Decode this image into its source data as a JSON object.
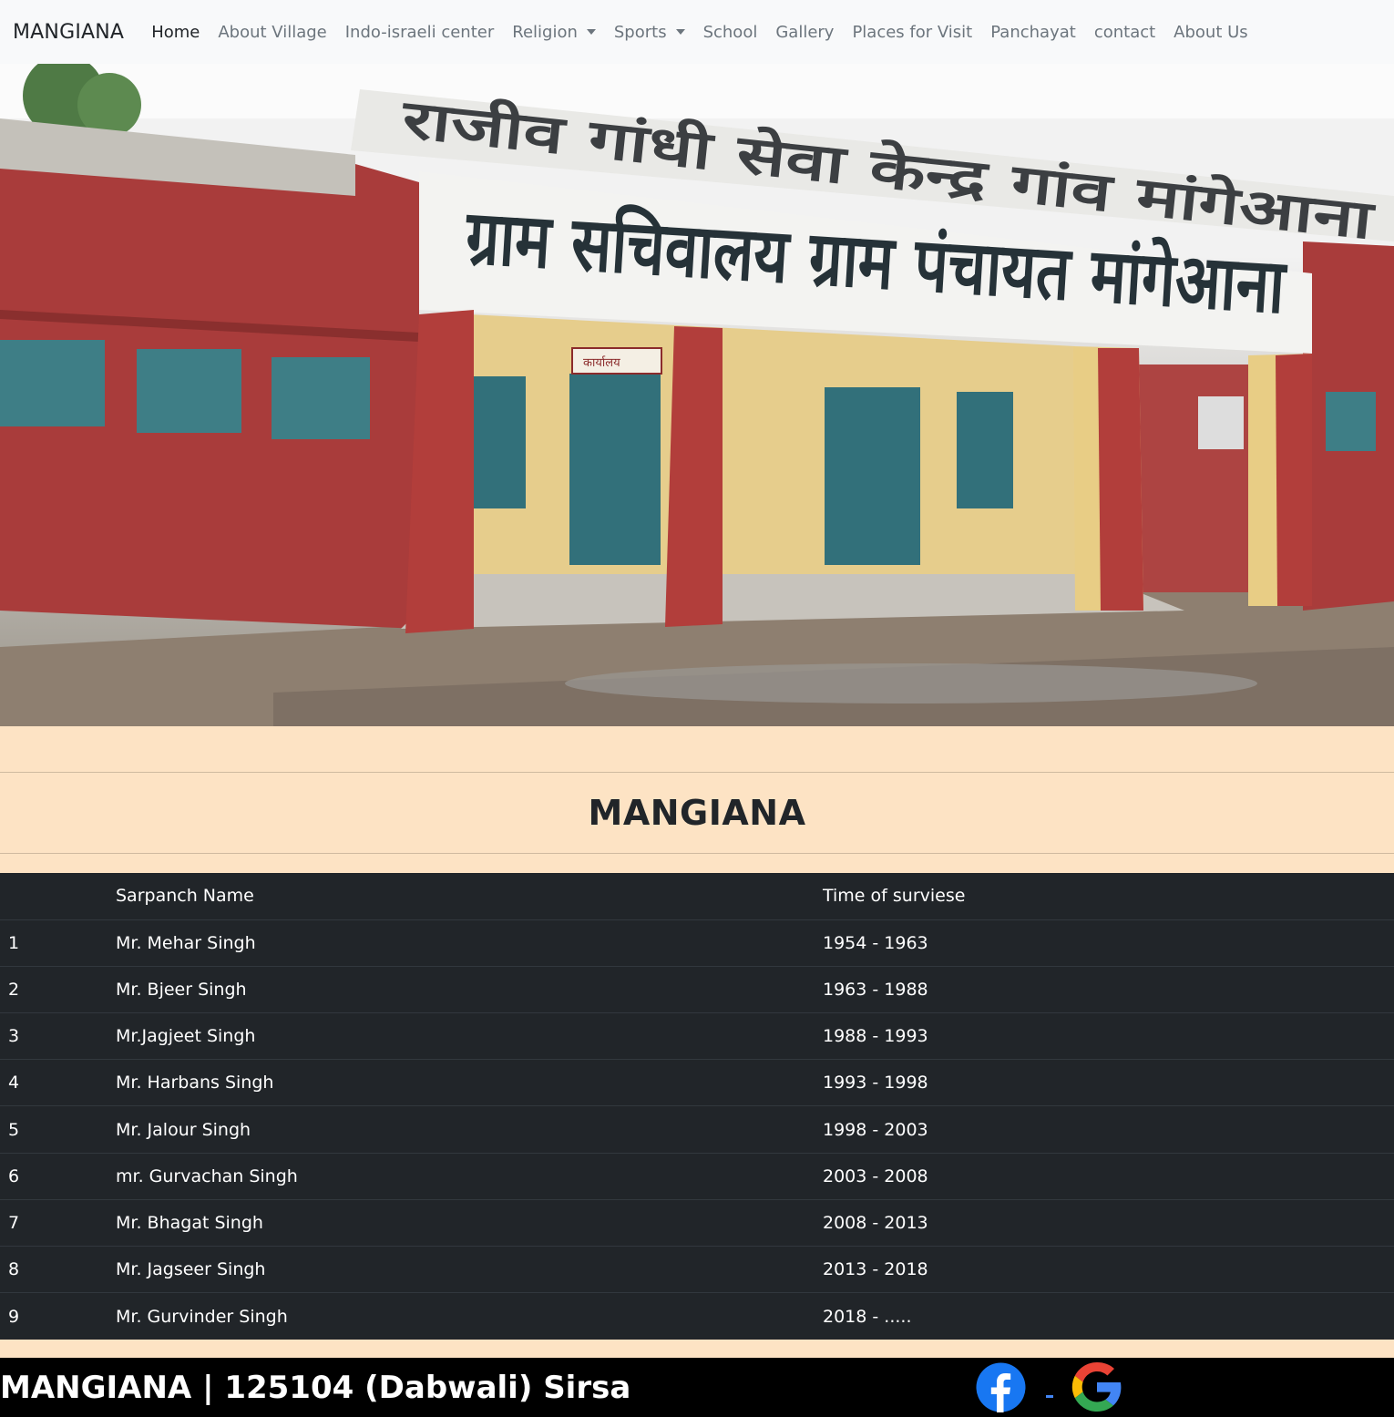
{
  "navbar": {
    "brand": "MANGIANA",
    "links": [
      {
        "label": "Home",
        "active": true
      },
      {
        "label": "About Village"
      },
      {
        "label": "Indo-israeli center"
      },
      {
        "label": "Religion",
        "dropdown": true
      },
      {
        "label": "Sports",
        "dropdown": true
      },
      {
        "label": "School"
      },
      {
        "label": "Gallery"
      },
      {
        "label": "Places for Visit"
      },
      {
        "label": "Panchayat"
      },
      {
        "label": "contact"
      },
      {
        "label": "About Us"
      }
    ]
  },
  "hero": {
    "sign_top": "राजीव गांधी सेवा केन्द्र गांव मांगेआना",
    "sign_main": "ग्राम सचिवालय ग्राम पंचायत मांगेआना",
    "door_sign": "कार्यालय"
  },
  "page_title": "MANGIANA",
  "table": {
    "headers": [
      "",
      "Sarpanch Name",
      "Time of surviese"
    ],
    "rows": [
      [
        "1",
        "Mr. Mehar Singh",
        "1954 - 1963"
      ],
      [
        "2",
        "Mr. Bjeer Singh",
        "1963 - 1988"
      ],
      [
        "3",
        "Mr.Jagjeet Singh",
        "1988 - 1993"
      ],
      [
        "4",
        "Mr. Harbans Singh",
        "1993 - 1998"
      ],
      [
        "5",
        "Mr. Jalour Singh",
        "1998 - 2003"
      ],
      [
        "6",
        "mr. Gurvachan Singh",
        "2003 - 2008"
      ],
      [
        "7",
        "Mr. Bhagat Singh",
        "2008 - 2013"
      ],
      [
        "8",
        "Mr. Jagseer Singh",
        "2013 - 2018"
      ],
      [
        "9",
        "Mr. Gurvinder Singh",
        "2018 - ....."
      ]
    ]
  },
  "footer": {
    "text": "MANGIANA | 125104 (Dabwali) Sirsa",
    "icons": [
      "facebook-icon",
      "google-icon"
    ]
  },
  "colors": {
    "navbar_bg": "#f8f9fa",
    "page_bg": "#fde3c4",
    "table_bg": "#212529",
    "footer_bg": "#000000",
    "facebook_blue": "#1877f2"
  }
}
